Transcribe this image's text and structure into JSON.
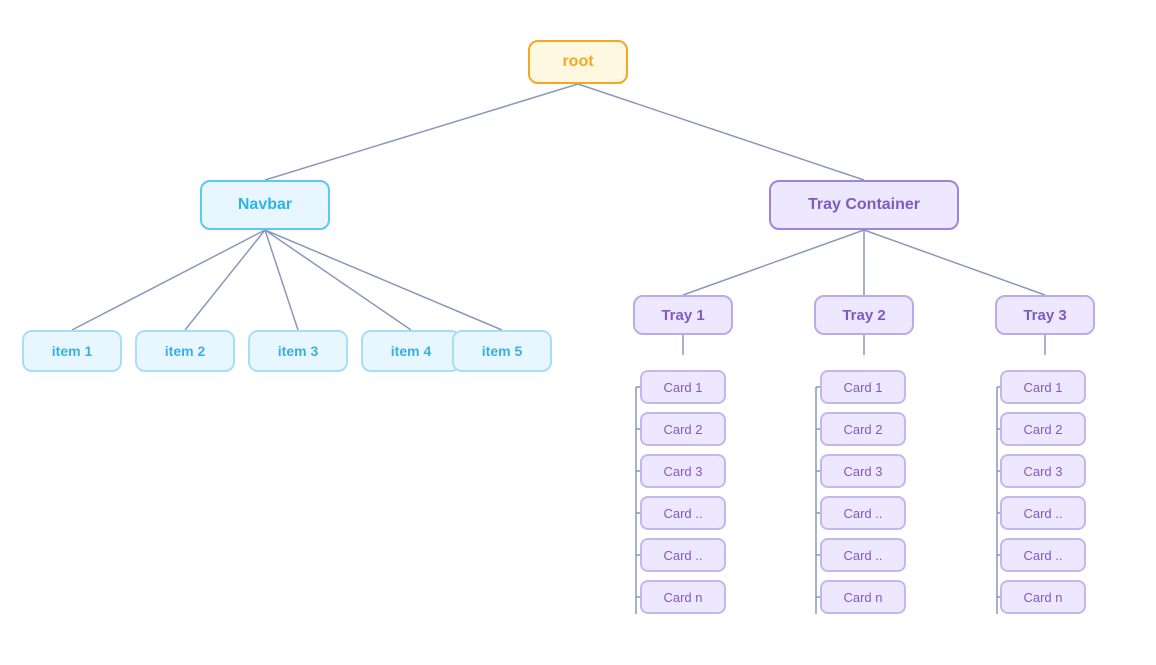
{
  "nodes": {
    "root": {
      "label": "root"
    },
    "navbar": {
      "label": "Navbar"
    },
    "tray_container": {
      "label": "Tray Container"
    },
    "items": [
      {
        "label": "item 1"
      },
      {
        "label": "item 2"
      },
      {
        "label": "item 3"
      },
      {
        "label": "item 4"
      },
      {
        "label": "item 5"
      }
    ],
    "trays": [
      {
        "label": "Tray 1"
      },
      {
        "label": "Tray 2"
      },
      {
        "label": "Tray 3"
      }
    ],
    "tray1_cards": [
      {
        "label": "Card 1"
      },
      {
        "label": "Card 2"
      },
      {
        "label": "Card 3"
      },
      {
        "label": "Card .."
      },
      {
        "label": "Card .."
      },
      {
        "label": "Card n"
      }
    ],
    "tray2_cards": [
      {
        "label": "Card 1"
      },
      {
        "label": "Card 2"
      },
      {
        "label": "Card 3"
      },
      {
        "label": "Card .."
      },
      {
        "label": "Card .."
      },
      {
        "label": "Card n"
      }
    ],
    "tray3_cards": [
      {
        "label": "Card 1"
      },
      {
        "label": "Card 2"
      },
      {
        "label": "Card 3"
      },
      {
        "label": "Card .."
      },
      {
        "label": "Card .."
      },
      {
        "label": "Card n"
      }
    ]
  },
  "colors": {
    "line": "#8899bb"
  }
}
